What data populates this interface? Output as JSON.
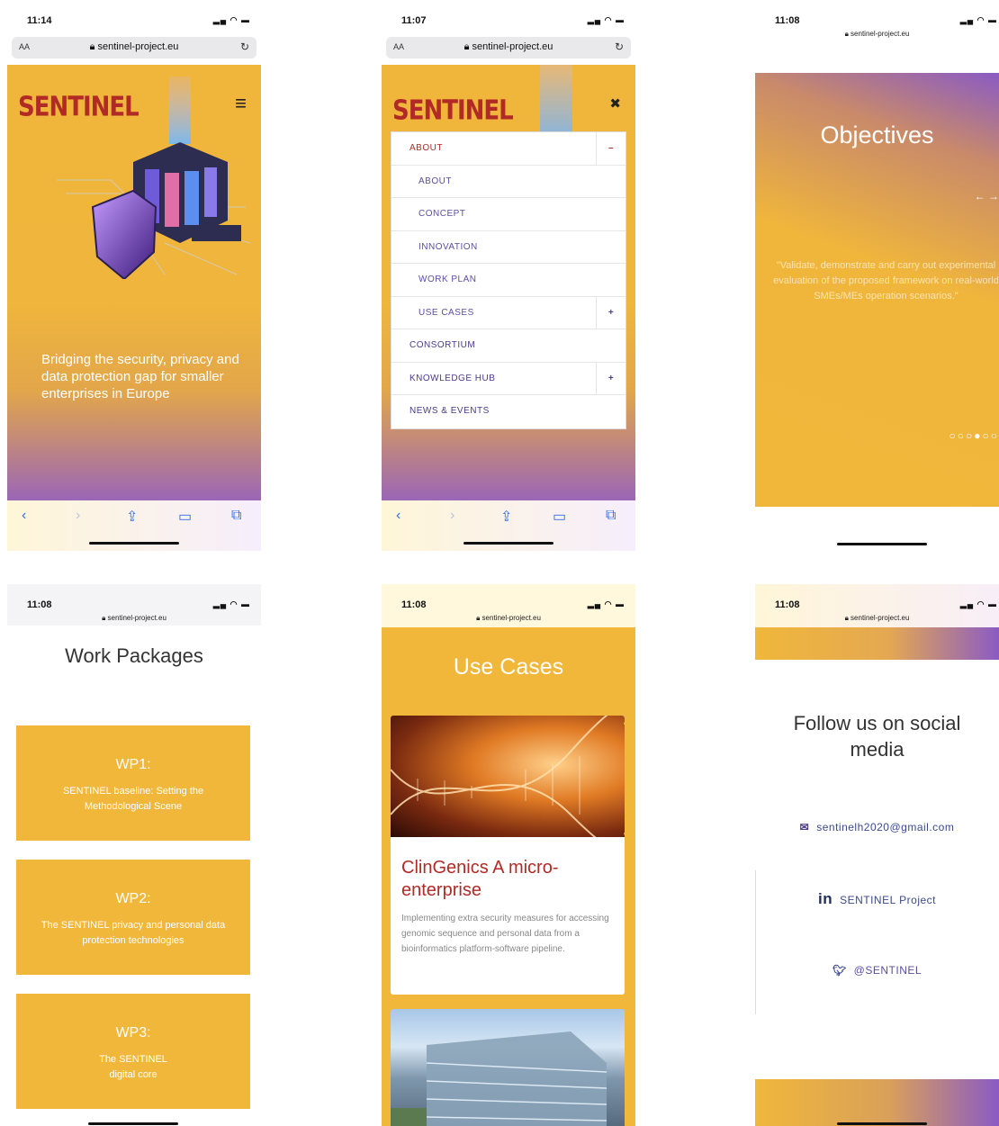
{
  "screen1": {
    "time": "11:14",
    "aa": "AA",
    "url": "sentinel-project.eu",
    "logo": "SENTINEL",
    "hamburger": "≡",
    "tagline": "Bridging the security, privacy and data protection gap for smaller enterprises in Europe",
    "nav": [
      "‹",
      "›",
      "⇪",
      "▭",
      "⧉"
    ]
  },
  "screen2": {
    "time": "11:07",
    "aa": "AA",
    "url": "sentinel-project.eu",
    "logo": "SENTINEL",
    "close": "✖",
    "menu": [
      {
        "label": "ABOUT",
        "toggle": "–",
        "kind": "open"
      },
      {
        "label": "ABOUT",
        "kind": "sub"
      },
      {
        "label": "CONCEPT",
        "kind": "sub"
      },
      {
        "label": "INNOVATION",
        "kind": "sub"
      },
      {
        "label": "WORK PLAN",
        "kind": "sub"
      },
      {
        "label": "USE CASES",
        "toggle": "+",
        "kind": "sub"
      },
      {
        "label": "CONSORTIUM",
        "kind": "top"
      },
      {
        "label": "KNOWLEDGE HUB",
        "toggle": "+",
        "kind": "top"
      },
      {
        "label": "NEWS & EVENTS",
        "kind": "top"
      }
    ],
    "nav": [
      "‹",
      "›",
      "⇪",
      "▭",
      "⧉"
    ]
  },
  "screen3": {
    "time": "11:08",
    "url": "sentinel-project.eu",
    "heading": "Objectives",
    "arrows": "← →",
    "quote": "\"Validate, demonstrate and carry out experimental evaluation of the proposed framework on real-world SMEs/MEs operation scenarios.\"",
    "dots": "○○○●○○",
    "active_dot": 4
  },
  "screen4": {
    "time": "11:08",
    "url": "sentinel-project.eu",
    "heading": "Work Packages",
    "cards": [
      {
        "title": "WP1:",
        "desc": "SENTINEL baseline: Setting the Methodological Scene"
      },
      {
        "title": "WP2:",
        "desc": "The SENTINEL privacy and personal data protection technologies"
      },
      {
        "title": "WP3:",
        "desc": "The SENTINEL digital core"
      }
    ]
  },
  "screen5": {
    "time": "11:08",
    "url": "sentinel-project.eu",
    "heading": "Use Cases",
    "card": {
      "title": "ClinGenics A micro-enterprise",
      "desc": "Implementing extra security measures for accessing genomic sequence and personal data from a bioinformatics platform-software pipeline."
    }
  },
  "screen6": {
    "time": "11:08",
    "url": "sentinel-project.eu",
    "heading": "Follow us on social media",
    "email": "sentinelh2020@gmail.com",
    "linkedin_mark": "in",
    "linkedin": "SENTINEL Project",
    "twitter": "@SENTINEL"
  },
  "colors": {
    "gold": "#f0b73b",
    "purple": "#8a5bc4",
    "brand_red": "#b12a26",
    "menu_text": "#4a3a8c"
  }
}
